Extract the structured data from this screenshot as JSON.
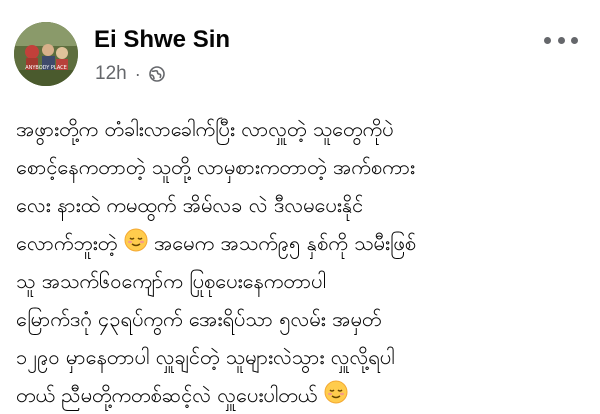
{
  "author": {
    "name": "Ei Shwe Sin",
    "avatar_text": "ANYBODY PLACE"
  },
  "meta": {
    "time": "12h",
    "separator": "·",
    "privacy_icon": "globe-icon"
  },
  "more_icon": "more-horizontal-icon",
  "post": {
    "lines": [
      "အဖွားတို့က တံခါးလာခေါက်ပြီး လာလှူတဲ့ သူတွေကိုပဲ",
      "စောင့်နေကတာတဲ့ သူတို့ လာမှစားကတာတဲ့ အက်စကား",
      "လေး နားထဲ ကမထွက်  အိမ်လခ လဲ ဒီလမပေးနိုင်",
      "လောက်ဘူးတဲ့ ",
      "အမေက အသက်၉၅ နှစ်ကို သမီးဖြစ်",
      "သူ အသက်၆၀ကျော်က ပြုစုပေးနေကတာပါ",
      "မြောက်ဒဂုံ ၄၃ရပ်ကွက် အေးရိပ်သာ ၅လမ်း အမှတ်",
      "၁၂၉၀ မှာနေတာပါ လှူချင်တဲ့ သူများလဲသွား လှူလို့ရပါ",
      "တယ် ညီမတို့ကတစ်ဆင့်လဲ လှူပေးပါတယ် "
    ],
    "emoji_name": "relieved-face-emoji"
  }
}
